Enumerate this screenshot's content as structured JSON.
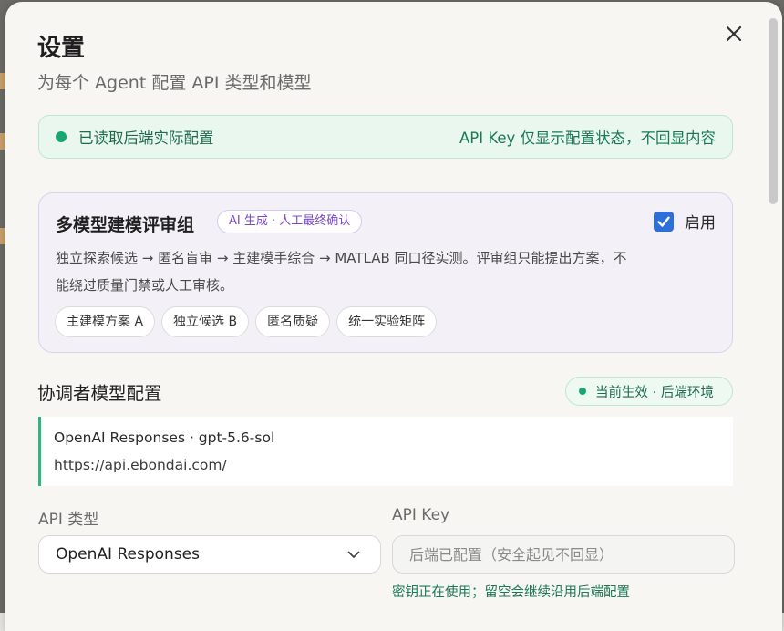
{
  "dialog": {
    "title": "设置",
    "subtitle": "为每个 Agent 配置 API 类型和模型",
    "close_icon": "close-icon"
  },
  "status_banner": {
    "text": "已读取后端实际配置",
    "note": "API Key 仅显示配置状态，不回显内容",
    "color": "#16a870"
  },
  "review_council": {
    "title": "多模型建模评审组",
    "badge": "AI 生成 · 人工最终确认",
    "enable_label": "启用",
    "enabled": true,
    "description": "独立探索候选 → 匿名盲审 → 主建模手综合 → MATLAB 同口径实测。评审组只能提出方案，不能绕过质量门禁或人工审核。",
    "chips": [
      "主建模方案 A",
      "独立候选 B",
      "匿名质疑",
      "统一实验矩阵"
    ]
  },
  "coordinator": {
    "section_title": "协调者模型配置",
    "live_badge": "当前生效 · 后端环境",
    "provider_line": "OpenAI Responses · gpt-5.6-sol",
    "endpoint": "https://api.ebondai.com/",
    "api_type_label": "API 类型",
    "api_type_value": "OpenAI Responses",
    "api_key_label": "API Key",
    "api_key_placeholder": "后端已配置（安全起见不回显）",
    "api_key_hint": "密钥正在使用；留空会继续沿用后端配置"
  }
}
